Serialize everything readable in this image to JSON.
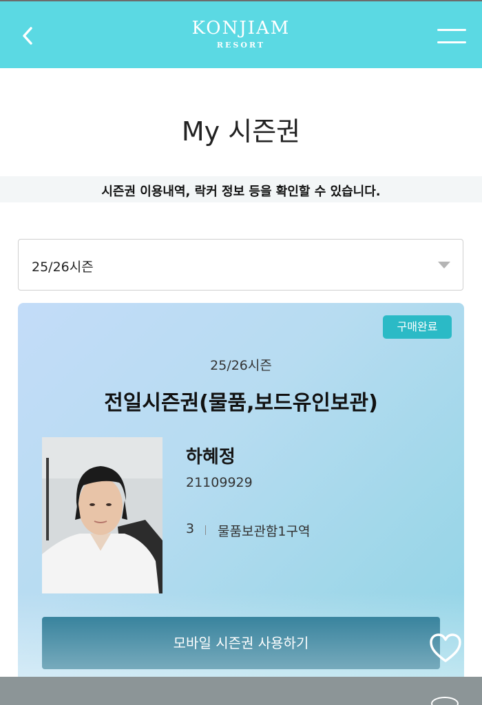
{
  "header": {
    "logo_main": "KONJIAM",
    "logo_sub": "RESORT",
    "bg_color": "#5bd9e3",
    "icons": {
      "back": "chevron-left-icon",
      "menu": "hamburger-menu-icon"
    }
  },
  "page": {
    "title": "My 시즌권",
    "description": "시즌권 이용내역, 락커 정보 등을 확인할 수 있습니다."
  },
  "season_select": {
    "selected": "25/26시즌"
  },
  "pass_card": {
    "status_badge": "구매완료",
    "season": "25/26시즌",
    "product": "전일시즌권(물품,보드유인보관)",
    "owner_name": "하혜정",
    "member_id": "21109929",
    "locker_number": "3",
    "locker_area": "물품보관함1구역",
    "use_button": "모바일 시즌권 사용하기",
    "accent_color": "#2bbac6",
    "button_color": "#1b718f"
  },
  "floating": {
    "icon": "heart-icon"
  }
}
